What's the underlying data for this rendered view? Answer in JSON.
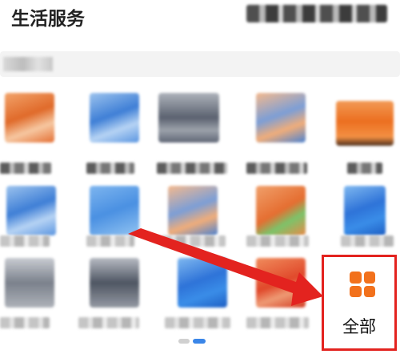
{
  "header": {
    "title": "生活服务"
  },
  "grid": {
    "items": [
      {
        "label": "",
        "icon": "blurred-orange-icon"
      },
      {
        "label": "",
        "icon": "blurred-blue-icon"
      },
      {
        "label": "",
        "icon": "blurred-gray-icon"
      },
      {
        "label": "",
        "icon": "blurred-mixed-icon"
      },
      {
        "label": "",
        "icon": "blurred-bag-icon"
      },
      {
        "label": "",
        "icon": "blurred-blue-icon"
      },
      {
        "label": "",
        "icon": "blurred-blue-icon"
      },
      {
        "label": "",
        "icon": "blurred-mixed-icon"
      },
      {
        "label": "",
        "icon": "blurred-orange-green-icon"
      },
      {
        "label": "",
        "icon": "blurred-deep-blue-icon"
      },
      {
        "label": "",
        "icon": "blurred-gray-icon"
      },
      {
        "label": "",
        "icon": "blurred-gray-icon"
      },
      {
        "label": "",
        "icon": "blurred-deep-blue-icon"
      },
      {
        "label": "",
        "icon": "blurred-orange-red-icon"
      }
    ],
    "all_button": {
      "label": "全部",
      "icon": "grid-four-squares-icon",
      "highlight_color": "#e3231f",
      "icon_color": "#f2711c"
    }
  },
  "pagination": {
    "pages": 2,
    "current": 2,
    "active_color": "#3a86e8"
  },
  "colors": {
    "annotation_arrow": "#e3231f"
  }
}
